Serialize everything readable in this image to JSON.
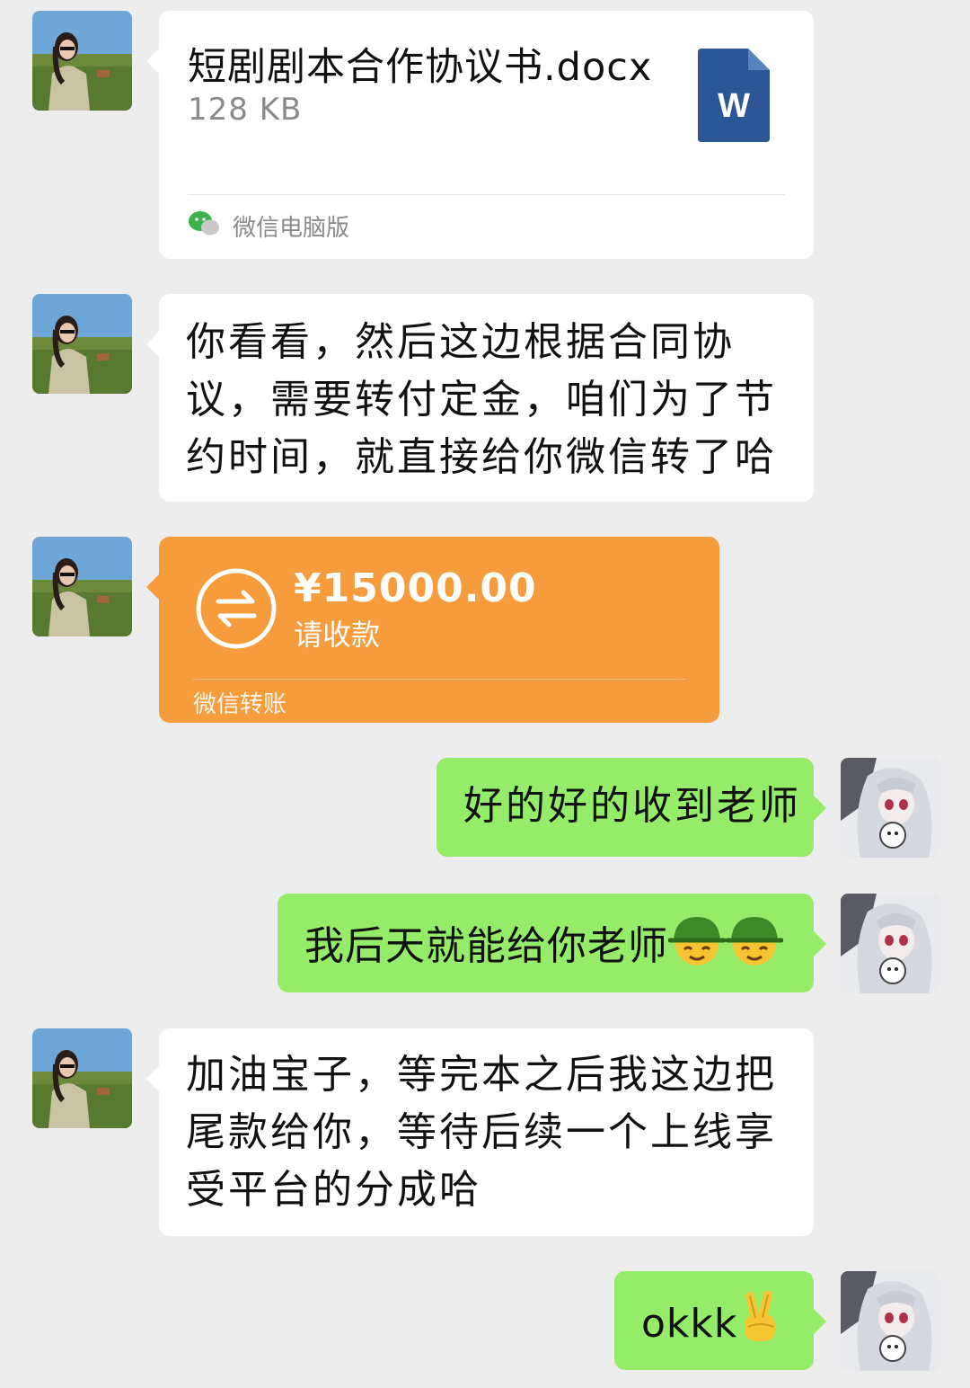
{
  "messages": {
    "file": {
      "name": "短剧剧本合作协议书.docx",
      "size": "128 KB",
      "source": "微信电脑版",
      "icon": "word-doc-icon",
      "icon_letter": "W"
    },
    "msg2": {
      "text": "你看看，然后这边根据合同协议，需要转付定金，咱们为了节约时间，就直接给你微信转了哈"
    },
    "transfer": {
      "amount": "¥15000.00",
      "status": "请收款",
      "label": "微信转账"
    },
    "msg4": {
      "text": "好的好的收到老师"
    },
    "msg5": {
      "text": "我后天就能给你老师",
      "emoji": "green-helmet-emoji"
    },
    "msg6": {
      "text": "加油宝子，等完本之后我这边把尾款给你，等待后续一个上线享受平台的分成哈"
    },
    "msg7": {
      "text": "okkk",
      "emoji": "victory-hand-emoji"
    }
  },
  "colors": {
    "background": "#ededed",
    "incoming_bubble": "#ffffff",
    "outgoing_bubble": "#95ec69",
    "transfer_bubble": "#f79c3c",
    "word_blue": "#2b5797"
  }
}
